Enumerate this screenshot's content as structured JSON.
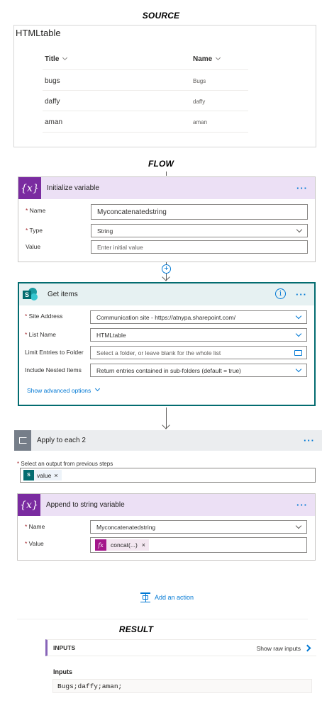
{
  "headings": {
    "source": "SOURCE",
    "flow": "FLOW",
    "result": "RESULT"
  },
  "source": {
    "list_title": "HTMLtable",
    "columns": [
      "Title",
      "Name"
    ],
    "rows": [
      {
        "title": "bugs",
        "name": "Bugs"
      },
      {
        "title": "daffy",
        "name": "daffy"
      },
      {
        "title": "aman",
        "name": "aman"
      }
    ]
  },
  "init_var": {
    "title": "Initialize variable",
    "icon": "{x}",
    "name_label": "Name",
    "name_value": "Myconcatenatedstring",
    "type_label": "Type",
    "type_value": "String",
    "value_label": "Value",
    "value_placeholder": "Enter initial value",
    "accent": "#7a2ba0"
  },
  "get_items": {
    "title": "Get items",
    "icon": "S",
    "site_label": "Site Address",
    "site_value": "Communication site - https://atnypa.sharepoint.com/",
    "list_label": "List Name",
    "list_value": "HTMLtable",
    "limit_label": "Limit Entries to Folder",
    "limit_placeholder": "Select a folder, or leave blank for the whole list",
    "nested_label": "Include Nested Items",
    "nested_value": "Return entries contained in sub-folders (default = true)",
    "advanced": "Show advanced options",
    "accent": "#036c70"
  },
  "apply_each": {
    "title": "Apply to each 2",
    "select_label": "Select an output from previous steps",
    "token_label": "value",
    "token_remove": "×"
  },
  "append": {
    "title": "Append to string variable",
    "icon": "{x}",
    "name_label": "Name",
    "name_value": "Myconcatenatedstring",
    "value_label": "Value",
    "token_icon": "fx",
    "token_label": "concat(...)",
    "token_remove": "×"
  },
  "add_action": "Add an action",
  "result": {
    "inputs_header": "INPUTS",
    "show_raw": "Show raw inputs",
    "inputs_label": "Inputs",
    "inputs_value": "Bugs;daffy;aman;"
  },
  "colors": {
    "variable_purple": "#7a2ba0",
    "variable_head": "#ece0f5",
    "sharepoint_teal": "#036c70",
    "sharepoint_head": "#e6f1f2",
    "apply_gray": "#767e89",
    "link_blue": "#0078d4"
  }
}
